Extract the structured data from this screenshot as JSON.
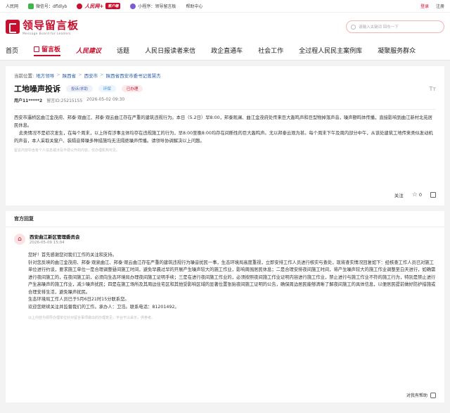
{
  "topbar": {
    "items": [
      {
        "label": "人民网"
      },
      {
        "label": "微信号：dfldlyb"
      },
      {
        "brand": "人民网+",
        "badge": "客户端"
      },
      {
        "label": "小程序：领导留言板"
      },
      {
        "label": "帮助中心"
      }
    ],
    "login": "登录",
    "register": "注册"
  },
  "header": {
    "logo_title": "领导留言板",
    "logo_subtitle": "Message Board for Leaders",
    "search_placeholder": "请输入关键词 回车一下"
  },
  "nav": {
    "home": "首页",
    "board": "留言板",
    "suggest_brand": "人民建议",
    "topics": "话题",
    "letters": "人民日报读者来信",
    "politics": "政企直通车",
    "community": "社会工作",
    "democracy": "全过程人民民主案例库",
    "service": "凝聚服务群众"
  },
  "message": {
    "breadcrumb": [
      "当前位置:",
      "地方领导",
      "陕西省",
      "西安市",
      "陕西省西安市委书记蒿慧杰"
    ],
    "title": "工地噪声投诉",
    "tags": [
      "投诉/求助",
      "环保",
      "已办理"
    ],
    "author": "用户11*****2",
    "message_id": "留言ID:25215155",
    "datetime": "2026-05-02 09:30",
    "paragraphs": [
      "西安市灞桥区曲江金茂府、邦泰·观曲江、邦泰·观云曲江存在严重的建筑违规行为。本日（5.2日）早8:00，邦泰观澜、曲江金茂府处传来巨大轰鸣声和巨型物掉落声音，噪声颤鸣体传播，直接影响到曲江新村北苑居民休息。",
      "此类情况不是初次发生，在每个周末，以上所有涉事主体均存在违规施工的行为，早8:00至晚8:00均存在间断性的巨大轰鸣声。尤以邦泰云观为甚。每个周末下午及周内部分中午，从该处建筑工地传来类似发动机的声音，本人采取关窗户、装隔音降噪多种措施均无法隔绝噪声传播。请领导协调解决以上问题。"
    ],
    "notice": "留言内容中含有个人信息或涉及不便公开的内容，仅办理机构可见。",
    "follow": "关注",
    "star_count": "0"
  },
  "reply": {
    "section_title": "官方回复",
    "org": "西安曲江新区管理委员会",
    "date": "2026-05-09 15:04",
    "paragraphs": [
      "您好！首先感谢您对我们工作的关注和支持。",
      "针对您反映的曲江金茂府、邦泰·观泉曲江、邦泰·观云曲江存在严重的建筑违规行为噪音扰民一事，生态环境局高度重视，立即安排工作人员进行核实与查处，现将查实情况回复如下：经核查工作人员已对施工单位进行约谈，要求施工单位一是合理调整昼间施工时间，避免早晨过早的开展产生噪声较大的施工作业，影响周围居民休息；二是合理安排夜间施工时间，将产生噪声较大的施工作业调整至白天进行，如确需进行夜间施工的，在夜间施工前，必须向生态环境局办理夜间施工证明手续；三是在进行夜间施工作业的，必须按照夜间施工作业证明内容进行施工作业，禁止进行与施工作业不符的施工行为，特别是禁止进行产生高噪声的施工作业，减少噪声扰民；四是在施工场所及其周边住宅区和其他受影响区域的显著位置张贴夜间施工证明的公告，确保周边居民能够清晰了解夜间施工的具体信息，以便居民提前做好防护措施或合理安排生活，避免噪声扰民。",
      "生态环境局工作人员已于5月6日21时15分联系您。",
      "欢迎您继续关注并监督我们的工作。承办人：卫浩。联系电话：81201492。"
    ],
    "notice": "以上内容为领导办理单位针对留言事项做出的办理意见，平台不以采示，供参考。",
    "useful": "对我有帮助"
  },
  "colors": {
    "brand_red": "#c8102e",
    "link_blue": "#2a5db0"
  }
}
